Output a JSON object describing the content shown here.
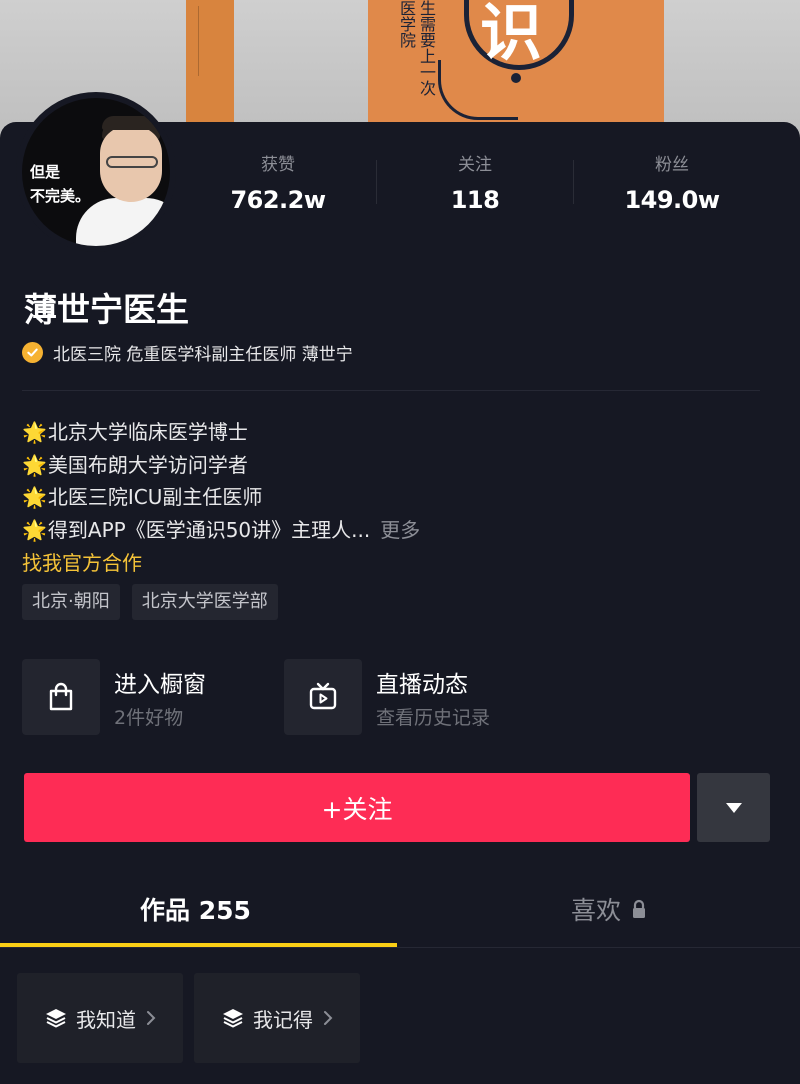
{
  "cover": {
    "book_lines": "生需要上一次医学院",
    "book_big_char": "识"
  },
  "avatar": {
    "text_line1": "但是",
    "text_line2": "不完美。"
  },
  "stats": [
    {
      "label": "获赞",
      "value": "762.2w"
    },
    {
      "label": "关注",
      "value": "118"
    },
    {
      "label": "粉丝",
      "value": "149.0w"
    }
  ],
  "profile": {
    "name": "薄世宁医生",
    "verification": "北医三院 危重医学科副主任医师 薄世宁"
  },
  "bio": {
    "lines": [
      "北京大学临床医学博士",
      "美国布朗大学访问学者",
      "北医三院ICU副主任医师",
      "得到APP《医学通识50讲》主理人..."
    ],
    "star": "🌟",
    "more": "更多",
    "cooperation": "找我官方合作"
  },
  "tags": [
    "北京·朝阳",
    "北京大学医学部"
  ],
  "entries": {
    "shop": {
      "title": "进入橱窗",
      "subtitle": "2件好物"
    },
    "live": {
      "title": "直播动态",
      "subtitle": "查看历史记录"
    }
  },
  "actions": {
    "follow": "+关注"
  },
  "tabs": {
    "works": "作品 255",
    "likes": "喜欢"
  },
  "collections": [
    "我知道",
    "我记得"
  ],
  "colors": {
    "background": "#161823",
    "follow": "#fe2c55",
    "accent_yellow": "#face15",
    "verify": "#f6b232"
  }
}
